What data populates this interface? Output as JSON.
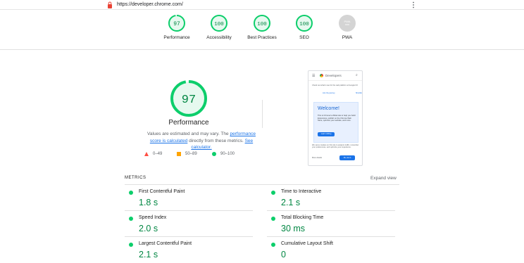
{
  "browser": {
    "url": "https://developer.chrome.com/"
  },
  "summary": [
    {
      "label": "Performance",
      "score": "97"
    },
    {
      "label": "Accessibility",
      "score": "100"
    },
    {
      "label": "Best Practices",
      "score": "100"
    },
    {
      "label": "SEO",
      "score": "100"
    },
    {
      "label": "PWA",
      "score": "PWA"
    }
  ],
  "performance": {
    "score": "97",
    "title": "Performance",
    "desc_before": "Values are estimated and may vary. The ",
    "desc_link1": "performance score is calculated",
    "desc_middle": " directly from these metrics. ",
    "desc_link2": "See calculator.",
    "legend": [
      {
        "range": "0–49",
        "shape": "triangle",
        "color": "#ff4e42"
      },
      {
        "range": "50–89",
        "shape": "square",
        "color": "#ffa400"
      },
      {
        "range": "90–100",
        "shape": "circle",
        "color": "#0cce6b"
      }
    ]
  },
  "screenshot": {
    "brand": "Developers",
    "note": "Check out what's new for the web platform at Google I/O",
    "link1": "Join the journey",
    "link2": "Shortlist",
    "welcome": "Welcome!",
    "card_text": "This is Chrome's official site to help you build Extensions, publish on the Chrome Web Store, optimize your website, and more.",
    "card_button": "Learn nothing",
    "cookie": "We serve cookies on this site to analyze traffic, remember your preferences, and optimize your experience.",
    "details": "More details",
    "agree": "Ok, Got it"
  },
  "metrics": {
    "heading": "METRICS",
    "expand": "Expand view",
    "items": [
      {
        "name": "First Contentful Paint",
        "value": "1.8 s"
      },
      {
        "name": "Time to Interactive",
        "value": "2.1 s"
      },
      {
        "name": "Speed Index",
        "value": "2.0 s"
      },
      {
        "name": "Total Blocking Time",
        "value": "30 ms"
      },
      {
        "name": "Largest Contentful Paint",
        "value": "2.1 s"
      },
      {
        "name": "Cumulative Layout Shift",
        "value": "0"
      }
    ]
  },
  "colors": {
    "pass": "#0cce6b",
    "pass_text": "#018642",
    "pass_fill": "#e6f9ef",
    "link": "#1a73e8",
    "pwa_gray": "#d4d4d4"
  }
}
